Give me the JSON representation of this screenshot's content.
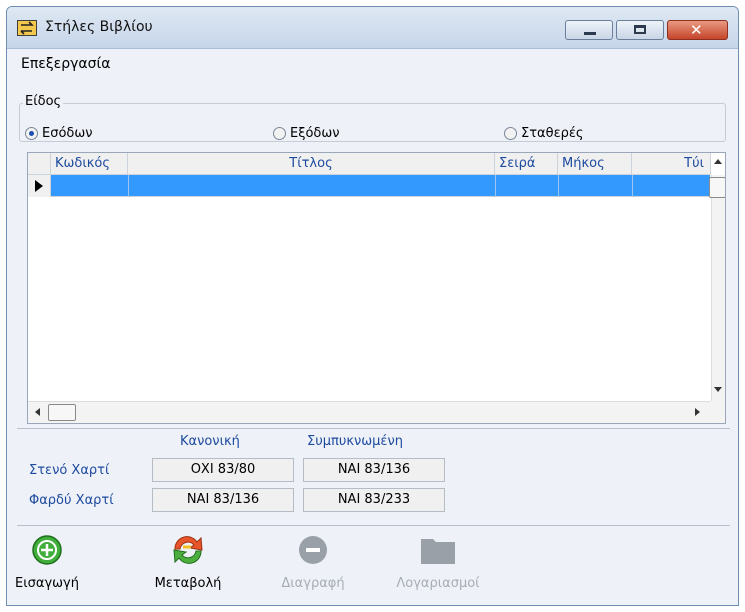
{
  "window": {
    "title": "Στήλες Βιβλίου"
  },
  "menu": {
    "edit_label": "Επεξεργασία"
  },
  "type_group": {
    "legend": "Είδος",
    "options": [
      {
        "label": "Εσόδων",
        "selected": true
      },
      {
        "label": "Εξόδων",
        "selected": false
      },
      {
        "label": "Σταθερές",
        "selected": false
      }
    ]
  },
  "grid": {
    "columns": [
      "Κωδικός",
      "Τίτλος",
      "Σειρά",
      "Μήκος",
      "Τύι"
    ],
    "selected_row_color": "#3399ff"
  },
  "paper": {
    "col_normal": "Κανονική",
    "col_compressed": "Συμπυκνωμένη",
    "rows": [
      {
        "label": "Στενό Χαρτί",
        "normal": "ΟΧΙ 83/80",
        "compressed": "ΝΑΙ 83/136"
      },
      {
        "label": "Φαρδύ Χαρτί",
        "normal": "ΝΑΙ 83/136",
        "compressed": "ΝΑΙ 83/233"
      }
    ]
  },
  "toolbar": {
    "insert": "Εισαγωγή",
    "modify": "Μεταβολή",
    "delete": "Διαγραφή",
    "accounts": "Λογαριασμοί"
  }
}
